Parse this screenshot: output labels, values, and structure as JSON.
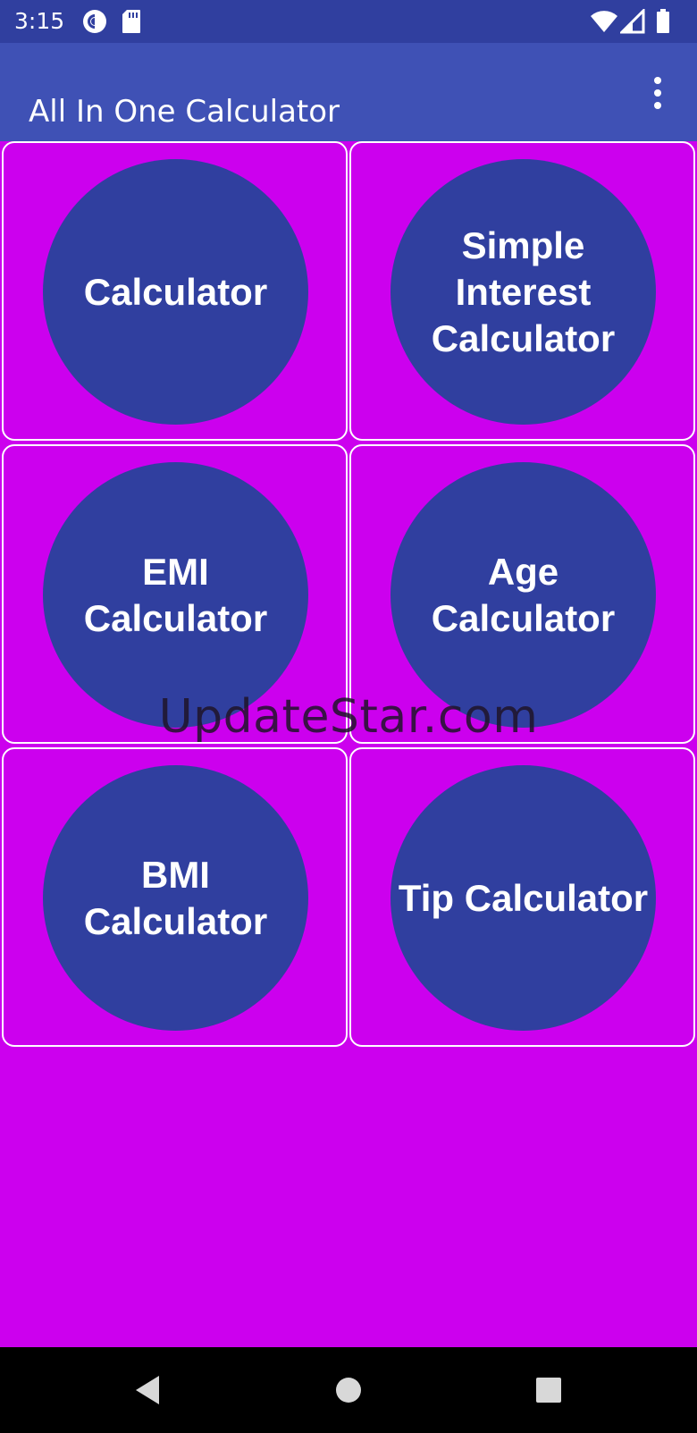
{
  "status_bar": {
    "time": "3:15",
    "icons": [
      "pocket-casts-icon",
      "sd-card-icon",
      "wifi-icon",
      "signal-icon",
      "battery-icon"
    ]
  },
  "app_bar": {
    "title": "All In One Calculator",
    "menu_icon": "more-vert-icon"
  },
  "tiles": [
    {
      "label": "Calculator"
    },
    {
      "label": "Simple\nInterest\nCalculator"
    },
    {
      "label": "EMI\nCalculator"
    },
    {
      "label": "Age\nCalculator"
    },
    {
      "label": "BMI\nCalculator"
    },
    {
      "label": "Tip Calculator"
    }
  ],
  "watermark": "UpdateStar.com",
  "nav_bar": {
    "icons": [
      "back-icon",
      "home-icon",
      "recents-icon"
    ]
  },
  "colors": {
    "status_bar": "#303f9f",
    "app_bar": "#3f51b5",
    "background": "#cc00ee",
    "circle": "#303f9f",
    "tile_border": "#ffffff",
    "nav_bar": "#000000"
  }
}
